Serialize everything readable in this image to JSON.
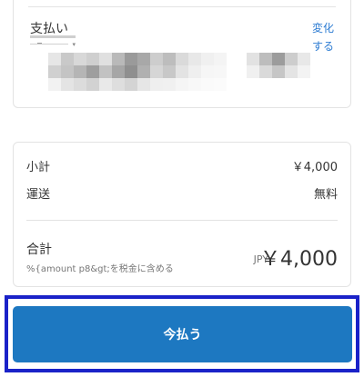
{
  "payment": {
    "label": "支払い",
    "change_link": "変化する"
  },
  "summary": {
    "subtotal_label": "小計",
    "subtotal_value": "￥4,000",
    "shipping_label": "運送",
    "shipping_value": "無料",
    "total_label": "合計",
    "tax_note": "%{amount p8&gt;を税金に含める",
    "currency": "JPY",
    "total_value": "￥4,000"
  },
  "actions": {
    "pay_now": "今払う"
  },
  "colors": {
    "accent": "#1d78c1",
    "link": "#2c7bd2",
    "focus_ring": "#1a22c8"
  }
}
